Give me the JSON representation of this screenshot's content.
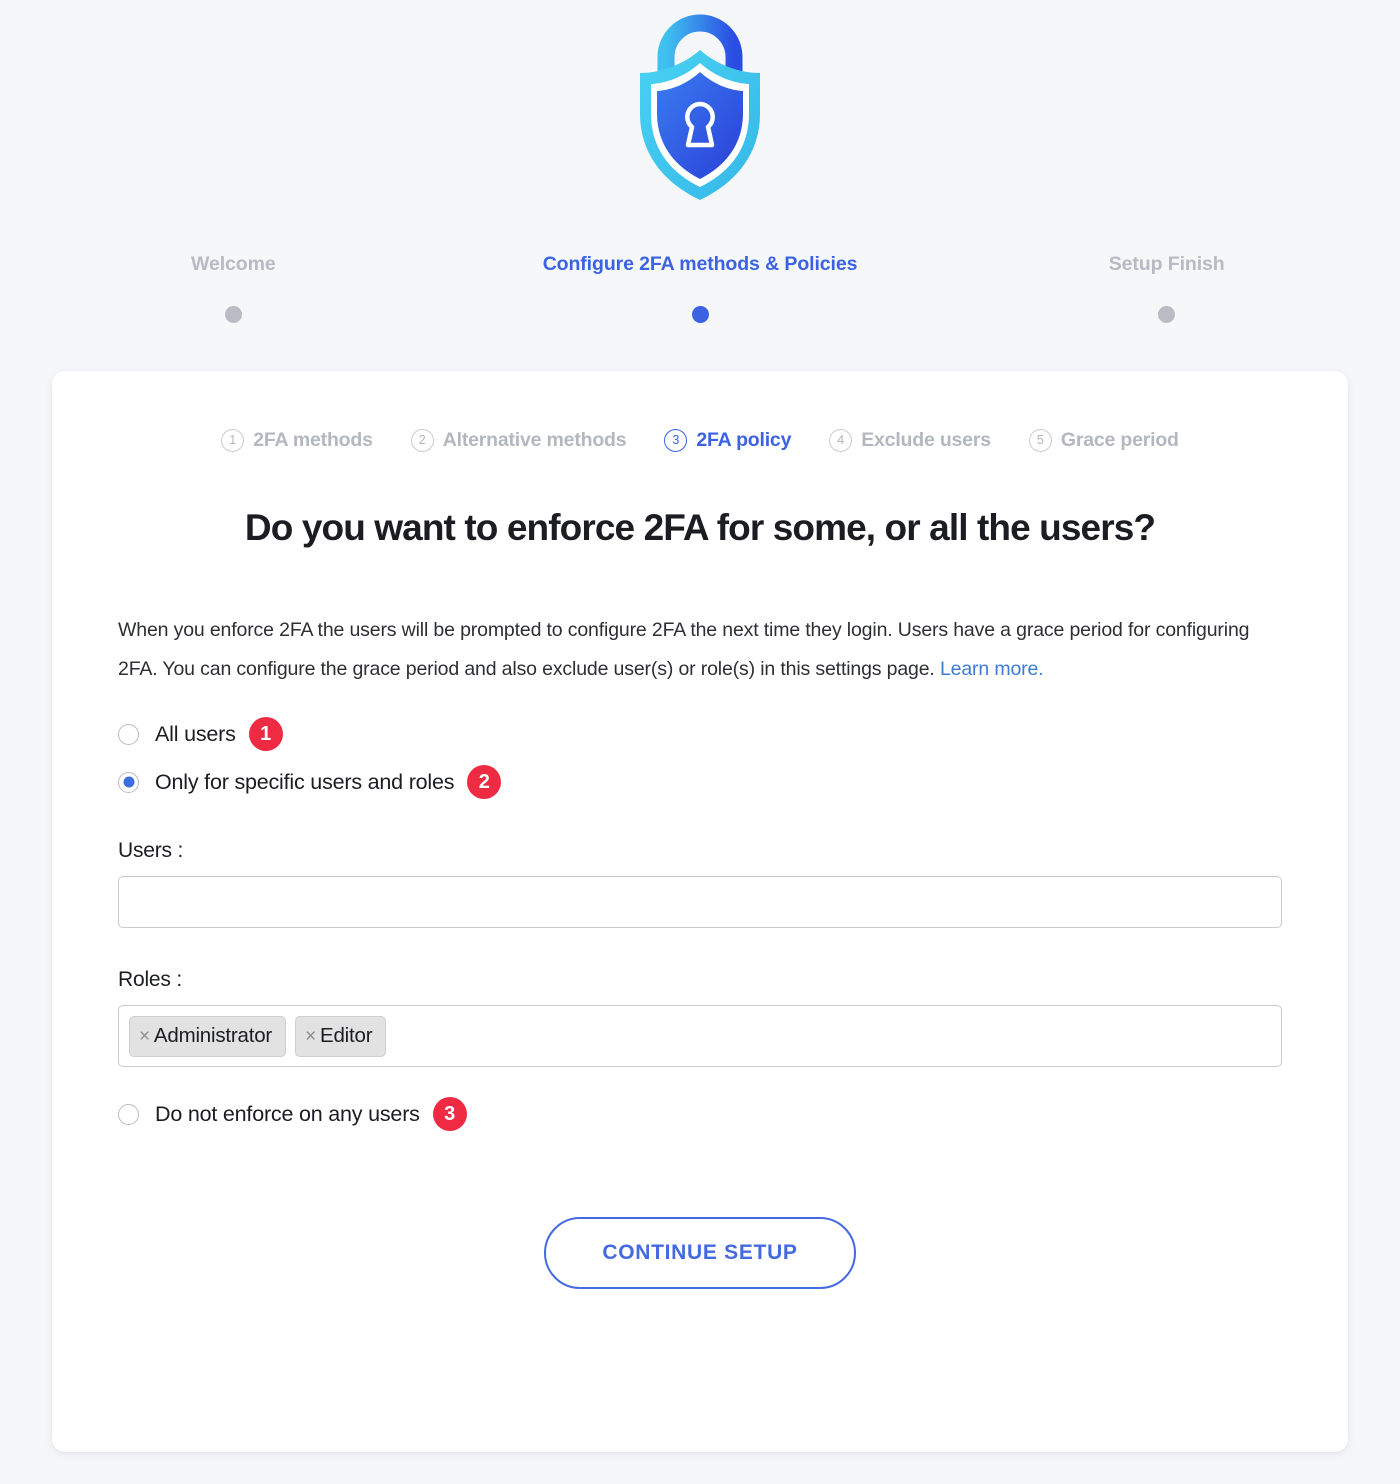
{
  "logo": {
    "icon": "shield-lock-icon",
    "outer_color": "#3fc6ef",
    "inner_color": "#2f57e0"
  },
  "wizard": {
    "steps": [
      {
        "label": "Welcome",
        "active": false
      },
      {
        "label": "Configure 2FA methods & Policies",
        "active": true
      },
      {
        "label": "Setup Finish",
        "active": false
      }
    ]
  },
  "substeps": [
    {
      "num": "1",
      "label": "2FA methods",
      "active": false
    },
    {
      "num": "2",
      "label": "Alternative methods",
      "active": false
    },
    {
      "num": "3",
      "label": "2FA policy",
      "active": true
    },
    {
      "num": "4",
      "label": "Exclude users",
      "active": false
    },
    {
      "num": "5",
      "label": "Grace period",
      "active": false
    }
  ],
  "main": {
    "heading": "Do you want to enforce 2FA for some, or all the users?",
    "description_text": "When you enforce 2FA the users will be prompted to configure 2FA the next time they login. Users have a grace period for configuring 2FA. You can configure the grace period and also exclude user(s) or role(s) in this settings page. ",
    "description_link": "Learn more.",
    "options": [
      {
        "label": "All users",
        "badge": "1",
        "checked": false
      },
      {
        "label": "Only for specific users and roles",
        "badge": "2",
        "checked": true
      },
      {
        "label": "Do not enforce on any users",
        "badge": "3",
        "checked": false
      }
    ],
    "users_field": {
      "label": "Users :",
      "value": "",
      "placeholder": ""
    },
    "roles_field": {
      "label": "Roles :",
      "chips": [
        {
          "label": "Administrator",
          "remove_icon": "close-icon"
        },
        {
          "label": "Editor",
          "remove_icon": "close-icon"
        }
      ]
    },
    "continue_button": "CONTINUE SETUP"
  },
  "colors": {
    "accent_blue": "#3b62e3",
    "badge_red": "#ef2b43",
    "link_blue": "#3d7cd6",
    "page_bg": "#f6f7f9",
    "muted_gray": "#b3b7bf"
  }
}
